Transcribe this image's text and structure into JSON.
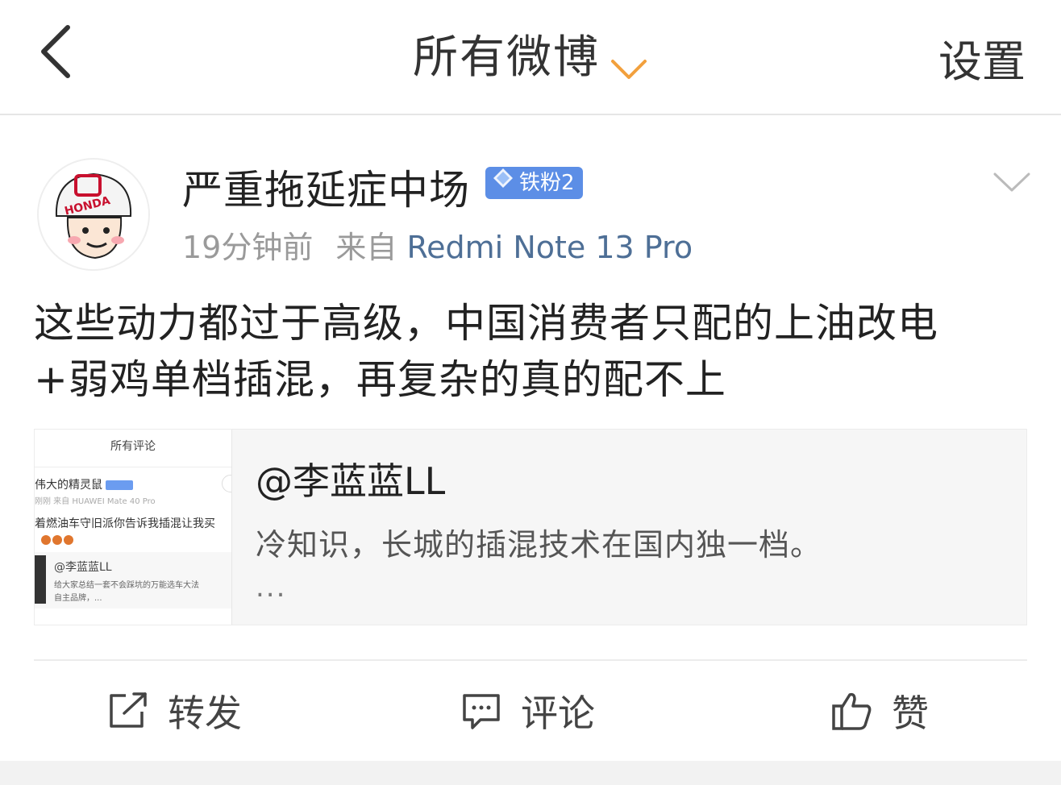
{
  "header": {
    "title": "所有微博",
    "settings_label": "设置"
  },
  "post": {
    "username": "严重拖延症中场",
    "badge": "铁粉2",
    "time": "19分钟前",
    "source_prefix": "来自",
    "device": "Redmi Note 13 Pro",
    "content_line1": "这些动力都过于高级，中国消费者只配的上油改电",
    "content_line2": "+弱鸡单档插混，再复杂的真的配不上",
    "avatar_logo_text": "HONDA"
  },
  "repost": {
    "author": "@李蓝蓝LL",
    "text": "冷知识，长城的插混技术在国内独一档。",
    "more": "...",
    "thumbnail": {
      "title": "所有评论",
      "name": "伟大的精灵鼠",
      "meta": "刚刚  来自 HUAWEI Mate 40 Pro",
      "text": "着燃油车守旧派你告诉我插混让我买",
      "quote_name": "@李蓝蓝LL",
      "quote_text": "给大家总结一套不会踩坑的万能选车大法",
      "quote_text2": "自主品牌，..."
    }
  },
  "actions": {
    "repost_label": "转发",
    "comment_label": "评论",
    "like_label": "赞"
  },
  "colors": {
    "accent_orange": "#f2a03d",
    "link_blue": "#4e6f96",
    "badge_blue": "#5c8ee6"
  }
}
